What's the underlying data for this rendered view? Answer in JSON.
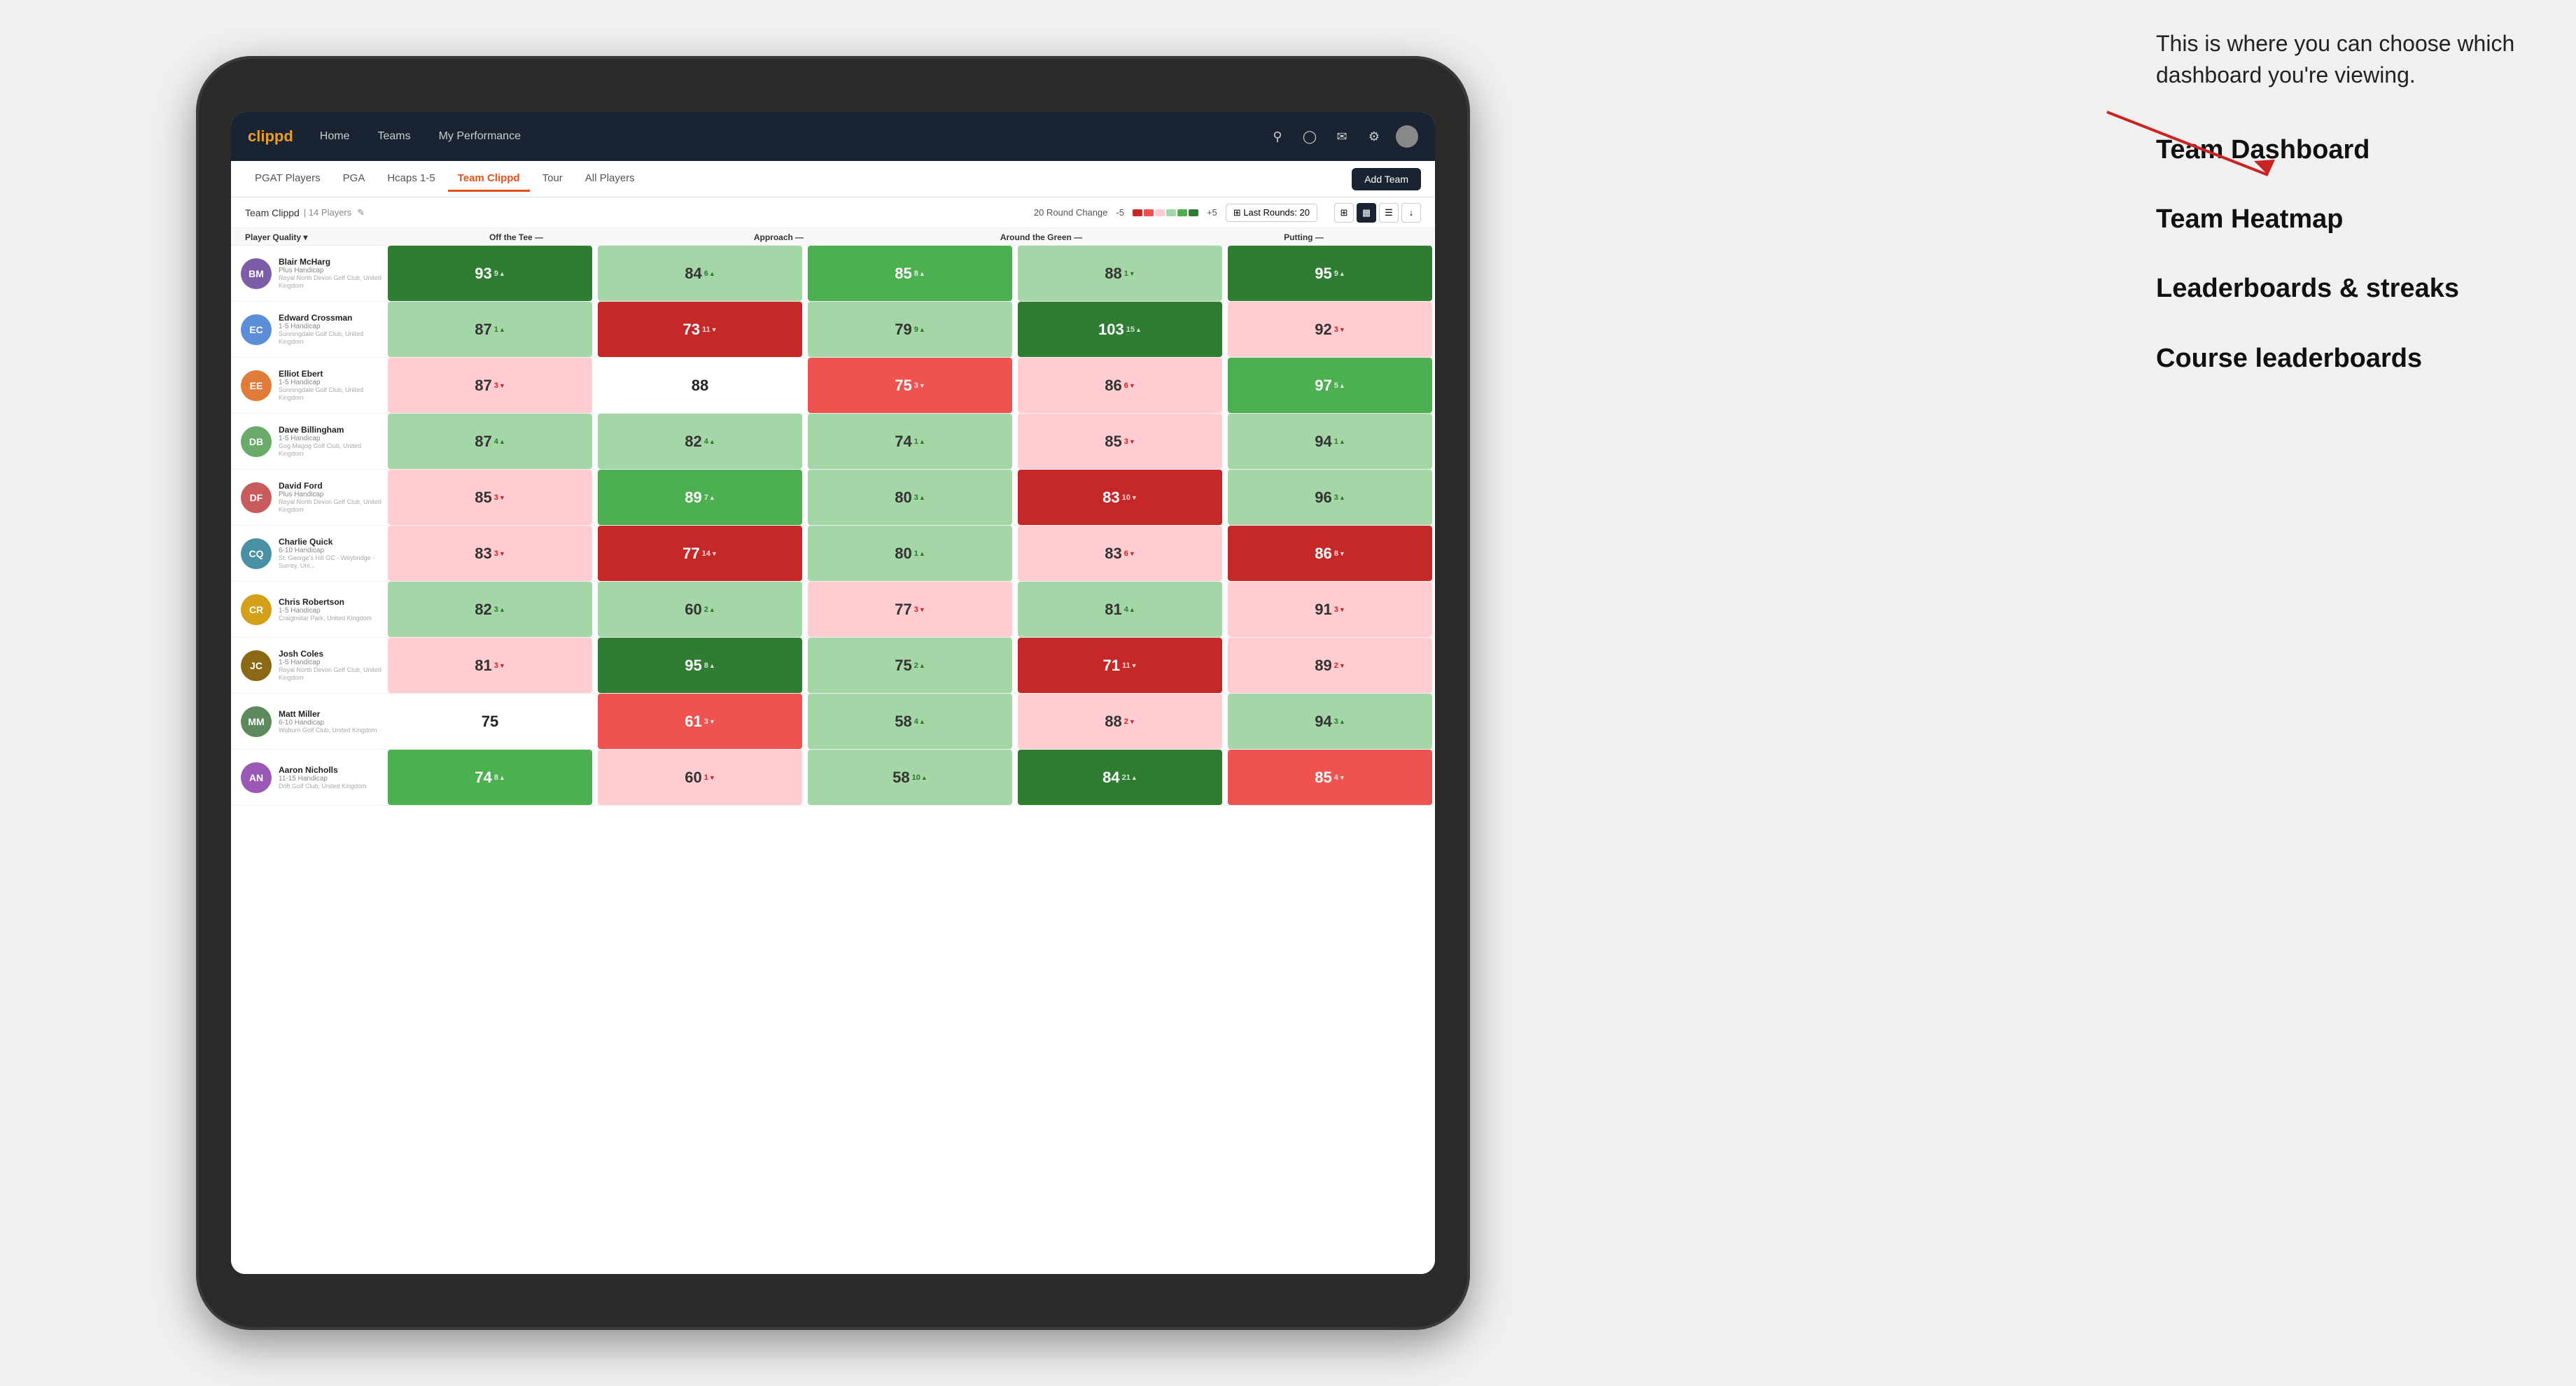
{
  "annotation": {
    "intro": "This is where you can choose which dashboard you're viewing.",
    "options": [
      "Team Dashboard",
      "Team Heatmap",
      "Leaderboards & streaks",
      "Course leaderboards"
    ]
  },
  "nav": {
    "logo": "clippd",
    "links": [
      "Home",
      "Teams",
      "My Performance"
    ],
    "icons": [
      "search",
      "user",
      "bell",
      "circle-plus",
      "avatar"
    ]
  },
  "sub_nav": {
    "links": [
      "PGAT Players",
      "PGA",
      "Hcaps 1-5",
      "Team Clippd",
      "Tour",
      "All Players"
    ],
    "active": "Team Clippd",
    "add_button": "Add Team"
  },
  "team_header": {
    "name": "Team Clippd",
    "count": "14 Players",
    "round_change_label": "20 Round Change",
    "range_min": "-5",
    "range_max": "+5",
    "last_rounds_label": "Last Rounds:",
    "last_rounds_value": "20"
  },
  "col_headers": {
    "player": "Player Quality ▾",
    "tee": "Off the Tee —",
    "approach": "Approach —",
    "around_green": "Around the Green —",
    "putting": "Putting —"
  },
  "players": [
    {
      "name": "Blair McHarg",
      "handicap": "Plus Handicap",
      "club": "Royal North Devon Golf Club, United Kingdom",
      "scores": [
        {
          "val": "93",
          "change": "9",
          "dir": "up",
          "color": "green-dark"
        },
        {
          "val": "84",
          "change": "6",
          "dir": "up",
          "color": "green-light"
        },
        {
          "val": "85",
          "change": "8",
          "dir": "up",
          "color": "green-med"
        },
        {
          "val": "88",
          "change": "1",
          "dir": "down",
          "color": "green-light"
        },
        {
          "val": "95",
          "change": "9",
          "dir": "up",
          "color": "green-dark"
        }
      ]
    },
    {
      "name": "Edward Crossman",
      "handicap": "1-5 Handicap",
      "club": "Sunningdale Golf Club, United Kingdom",
      "scores": [
        {
          "val": "87",
          "change": "1",
          "dir": "up",
          "color": "green-light"
        },
        {
          "val": "73",
          "change": "11",
          "dir": "down",
          "color": "red-dark"
        },
        {
          "val": "79",
          "change": "9",
          "dir": "up",
          "color": "green-light"
        },
        {
          "val": "103",
          "change": "15",
          "dir": "up",
          "color": "green-dark"
        },
        {
          "val": "92",
          "change": "3",
          "dir": "down",
          "color": "red-light"
        }
      ]
    },
    {
      "name": "Elliot Ebert",
      "handicap": "1-5 Handicap",
      "club": "Sunningdale Golf Club, United Kingdom",
      "scores": [
        {
          "val": "87",
          "change": "3",
          "dir": "down",
          "color": "red-light"
        },
        {
          "val": "88",
          "change": "",
          "dir": "",
          "color": "white-cell"
        },
        {
          "val": "75",
          "change": "3",
          "dir": "down",
          "color": "red-med"
        },
        {
          "val": "86",
          "change": "6",
          "dir": "down",
          "color": "red-light"
        },
        {
          "val": "97",
          "change": "5",
          "dir": "up",
          "color": "green-med"
        }
      ]
    },
    {
      "name": "Dave Billingham",
      "handicap": "1-5 Handicap",
      "club": "Gog Magog Golf Club, United Kingdom",
      "scores": [
        {
          "val": "87",
          "change": "4",
          "dir": "up",
          "color": "green-light"
        },
        {
          "val": "82",
          "change": "4",
          "dir": "up",
          "color": "green-light"
        },
        {
          "val": "74",
          "change": "1",
          "dir": "up",
          "color": "green-light"
        },
        {
          "val": "85",
          "change": "3",
          "dir": "down",
          "color": "red-light"
        },
        {
          "val": "94",
          "change": "1",
          "dir": "up",
          "color": "green-light"
        }
      ]
    },
    {
      "name": "David Ford",
      "handicap": "Plus Handicap",
      "club": "Royal North Devon Golf Club, United Kingdom",
      "scores": [
        {
          "val": "85",
          "change": "3",
          "dir": "down",
          "color": "red-light"
        },
        {
          "val": "89",
          "change": "7",
          "dir": "up",
          "color": "green-med"
        },
        {
          "val": "80",
          "change": "3",
          "dir": "up",
          "color": "green-light"
        },
        {
          "val": "83",
          "change": "10",
          "dir": "down",
          "color": "red-dark"
        },
        {
          "val": "96",
          "change": "3",
          "dir": "up",
          "color": "green-light"
        }
      ]
    },
    {
      "name": "Charlie Quick",
      "handicap": "6-10 Handicap",
      "club": "St. George's Hill GC - Weybridge - Surrey, Uni...",
      "scores": [
        {
          "val": "83",
          "change": "3",
          "dir": "down",
          "color": "red-light"
        },
        {
          "val": "77",
          "change": "14",
          "dir": "down",
          "color": "red-dark"
        },
        {
          "val": "80",
          "change": "1",
          "dir": "up",
          "color": "green-light"
        },
        {
          "val": "83",
          "change": "6",
          "dir": "down",
          "color": "red-light"
        },
        {
          "val": "86",
          "change": "8",
          "dir": "down",
          "color": "red-dark"
        }
      ]
    },
    {
      "name": "Chris Robertson",
      "handicap": "1-5 Handicap",
      "club": "Craigmillar Park, United Kingdom",
      "scores": [
        {
          "val": "82",
          "change": "3",
          "dir": "up",
          "color": "green-light"
        },
        {
          "val": "60",
          "change": "2",
          "dir": "up",
          "color": "green-light"
        },
        {
          "val": "77",
          "change": "3",
          "dir": "down",
          "color": "red-light"
        },
        {
          "val": "81",
          "change": "4",
          "dir": "up",
          "color": "green-light"
        },
        {
          "val": "91",
          "change": "3",
          "dir": "down",
          "color": "red-light"
        }
      ]
    },
    {
      "name": "Josh Coles",
      "handicap": "1-5 Handicap",
      "club": "Royal North Devon Golf Club, United Kingdom",
      "scores": [
        {
          "val": "81",
          "change": "3",
          "dir": "down",
          "color": "red-light"
        },
        {
          "val": "95",
          "change": "8",
          "dir": "up",
          "color": "green-dark"
        },
        {
          "val": "75",
          "change": "2",
          "dir": "up",
          "color": "green-light"
        },
        {
          "val": "71",
          "change": "11",
          "dir": "down",
          "color": "red-dark"
        },
        {
          "val": "89",
          "change": "2",
          "dir": "down",
          "color": "red-light"
        }
      ]
    },
    {
      "name": "Matt Miller",
      "handicap": "6-10 Handicap",
      "club": "Woburn Golf Club, United Kingdom",
      "scores": [
        {
          "val": "75",
          "change": "",
          "dir": "",
          "color": "white-cell"
        },
        {
          "val": "61",
          "change": "3",
          "dir": "down",
          "color": "red-med"
        },
        {
          "val": "58",
          "change": "4",
          "dir": "up",
          "color": "green-light"
        },
        {
          "val": "88",
          "change": "2",
          "dir": "down",
          "color": "red-light"
        },
        {
          "val": "94",
          "change": "3",
          "dir": "up",
          "color": "green-light"
        }
      ]
    },
    {
      "name": "Aaron Nicholls",
      "handicap": "11-15 Handicap",
      "club": "Drift Golf Club, United Kingdom",
      "scores": [
        {
          "val": "74",
          "change": "8",
          "dir": "up",
          "color": "green-med"
        },
        {
          "val": "60",
          "change": "1",
          "dir": "down",
          "color": "red-light"
        },
        {
          "val": "58",
          "change": "10",
          "dir": "up",
          "color": "green-light"
        },
        {
          "val": "84",
          "change": "21",
          "dir": "up",
          "color": "green-dark"
        },
        {
          "val": "85",
          "change": "4",
          "dir": "down",
          "color": "red-med"
        }
      ]
    }
  ]
}
